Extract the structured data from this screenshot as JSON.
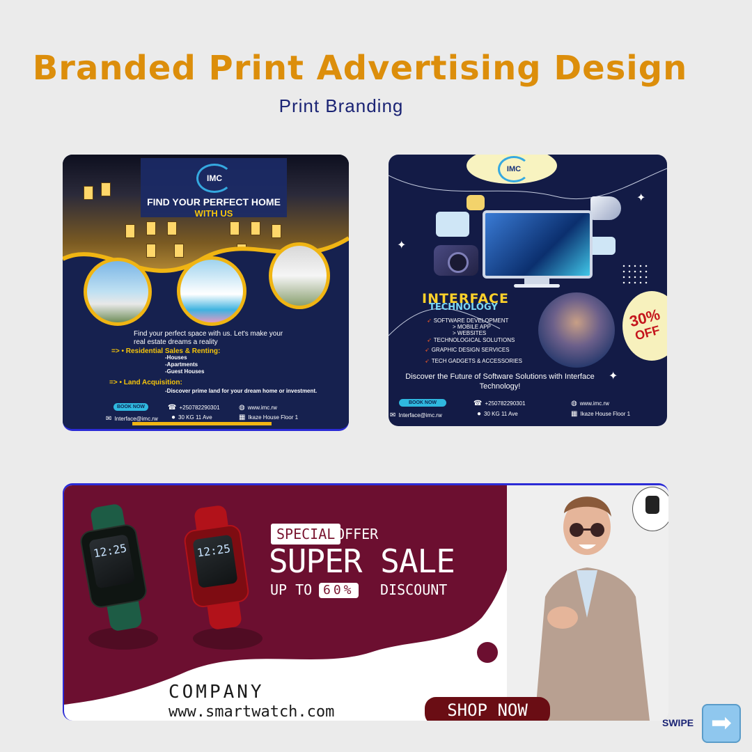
{
  "header": {
    "title": "Branded Print Advertising Design",
    "subtitle": "Print Branding"
  },
  "real_estate_card": {
    "logo": "IMC",
    "headline_1": "FIND YOUR PERFECT HOME",
    "headline_2": "WITH US",
    "intro": "Find your perfect space with us. Let's make your real estate dreams a reality",
    "section_1": "=> •  Residential Sales & Renting:",
    "section_1_items": [
      "-Houses",
      "-Apartments",
      "-Guest Houses"
    ],
    "section_2": "=> •  Land Acquisition:",
    "section_2_text": "-Discover prime land for your dream home or investment.",
    "book_now": "BOOK NOW",
    "phone": "+250782290301",
    "website": "www.imc.rw",
    "email": "Interface@imc.rw",
    "address": "30 KG 11 Ave",
    "building": "Ikaze House Floor 1",
    "accent_color": "#f0b513",
    "bg_color": "#16214f"
  },
  "interface_card": {
    "logo": "IMC",
    "title_1": "INTERFACE",
    "title_2": "TECHNOLOGY",
    "services": [
      "SOFTWARE DEVELOPMENT",
      "> MOBILE APP",
      "> WEBSITES",
      "TECHNOLOGICAL SOLUTIONS",
      "GRAPHIC DESIGN SERVICES",
      "TECH GADGETS & ACCESSORIES"
    ],
    "offer_number": "30%",
    "offer_word": "OFF",
    "discover": "Discover the Future of Software Solutions with Interface Technology!",
    "book_now": "BOOK NOW",
    "phone": "+250782290301",
    "website": "www.imc.rw",
    "email": "Interface@imc.rw",
    "address": "30 KG 11 Ave",
    "building": "Ikaze House Floor 1",
    "bg_color": "#131b46"
  },
  "smartwatch_card": {
    "special": "SPECIAL",
    "offer": "OFFER",
    "super_sale": "SUPER SALE",
    "up_to": "UP TO",
    "percent": "60%",
    "discount": "DISCOUNT",
    "company": "COMPANY",
    "url": "www.smartwatch.com",
    "shop_now": "SHOP NOW",
    "watch_time": "12:25",
    "maroon_color": "#6c0f30"
  },
  "swipe": {
    "label": "SWIPE",
    "icon": "right-arrow-icon"
  }
}
